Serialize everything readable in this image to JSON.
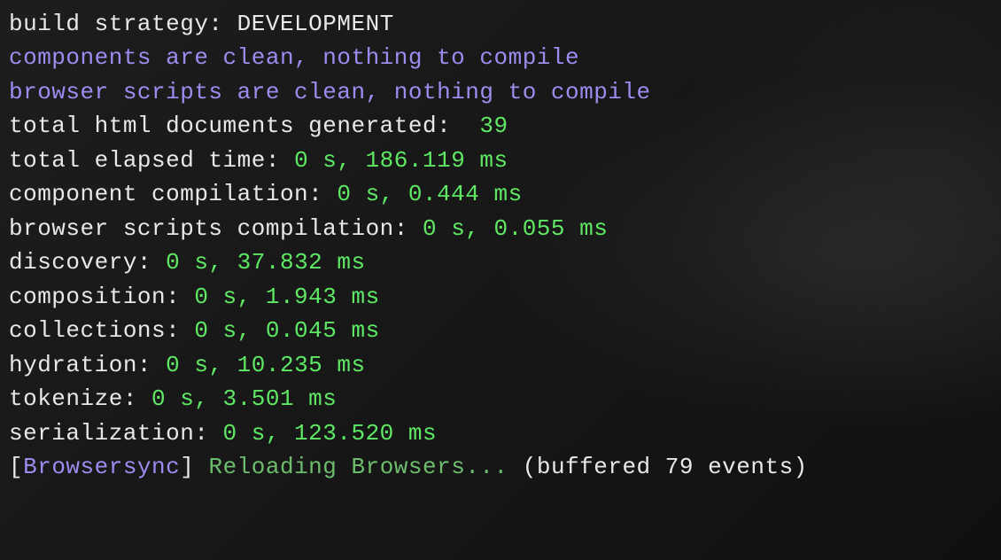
{
  "lines": {
    "build_strategy_label": "build strategy: ",
    "build_strategy_value": "DEVELOPMENT",
    "components_clean": "components are clean, nothing to compile",
    "browser_scripts_clean": "browser scripts are clean, nothing to compile",
    "total_html_label": "total html documents generated:  ",
    "total_html_value": "39",
    "total_elapsed_label": "total elapsed time: ",
    "total_elapsed_value": "0 s, 186.119 ms",
    "component_compilation_label": "component compilation: ",
    "component_compilation_value": "0 s, 0.444 ms",
    "browser_scripts_compilation_label": "browser scripts compilation: ",
    "browser_scripts_compilation_value": "0 s, 0.055 ms",
    "discovery_label": "discovery: ",
    "discovery_value": "0 s, 37.832 ms",
    "composition_label": "composition: ",
    "composition_value": "0 s, 1.943 ms",
    "collections_label": "collections: ",
    "collections_value": "0 s, 0.045 ms",
    "hydration_label": "hydration: ",
    "hydration_value": "0 s, 10.235 ms",
    "tokenize_label": "tokenize: ",
    "tokenize_value": "0 s, 3.501 ms",
    "serialization_label": "serialization: ",
    "serialization_value": "0 s, 123.520 ms",
    "browsersync_bracket_open": "[",
    "browsersync_name": "Browsersync",
    "browsersync_bracket_close": "] ",
    "browsersync_reloading": "Reloading Browsers... ",
    "browsersync_buffered": "(buffered 79 events)"
  }
}
